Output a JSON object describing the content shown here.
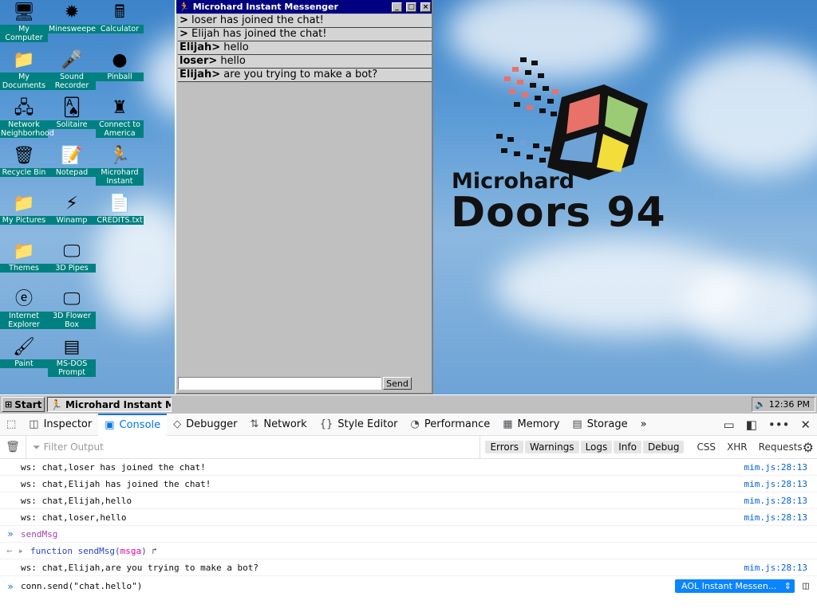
{
  "desktop": {
    "icons": [
      {
        "label": "My Computer",
        "icon": "computer-icon",
        "glyph": "🖥"
      },
      {
        "label": "Minesweeper",
        "icon": "mine-icon",
        "glyph": "✹"
      },
      {
        "label": "Calculator",
        "icon": "calculator-icon",
        "glyph": "🖩"
      },
      {
        "label": "My Documents",
        "icon": "folder-icon",
        "glyph": "📁"
      },
      {
        "label": "Sound Recorder",
        "icon": "microphone-icon",
        "glyph": "🎤"
      },
      {
        "label": "Pinball",
        "icon": "pinball-icon",
        "glyph": "●"
      },
      {
        "label": "Network Neighborhood",
        "icon": "network-icon",
        "glyph": "🖧"
      },
      {
        "label": "Solitaire",
        "icon": "cards-icon",
        "glyph": "🂡"
      },
      {
        "label": "Connect to America",
        "icon": "connect-icon",
        "glyph": "♜"
      },
      {
        "label": "Recycle Bin",
        "icon": "recycle-bin-icon",
        "glyph": "🗑"
      },
      {
        "label": "Notepad",
        "icon": "notepad-icon",
        "glyph": "📝"
      },
      {
        "label": "Microhard Instant",
        "icon": "running-man-icon",
        "glyph": "🏃"
      },
      {
        "label": "My Pictures",
        "icon": "folder-icon",
        "glyph": "📁"
      },
      {
        "label": "Winamp",
        "icon": "winamp-icon",
        "glyph": "⚡"
      },
      {
        "label": "CREDITS.txt",
        "icon": "text-file-icon",
        "glyph": "📄"
      },
      {
        "label": "Themes",
        "icon": "folder-icon",
        "glyph": "📁"
      },
      {
        "label": "3D Pipes",
        "icon": "monitor-icon",
        "glyph": "🖵"
      },
      {
        "label": "Internet Explorer",
        "icon": "ie-icon",
        "glyph": "ⓔ"
      },
      {
        "label": "3D Flower Box",
        "icon": "monitor-icon",
        "glyph": "🖵"
      },
      {
        "label": "Paint",
        "icon": "paint-icon",
        "glyph": "🖌"
      },
      {
        "label": "MS-DOS Prompt",
        "icon": "msdos-icon",
        "glyph": "▤"
      }
    ]
  },
  "messenger": {
    "title": "Microhard Instant Messenger",
    "lines": [
      {
        "prefix": ">",
        "text": " loser has joined the chat!"
      },
      {
        "prefix": ">",
        "text": " Elijah has joined the chat!"
      },
      {
        "prefix": "Elijah>",
        "text": " hello"
      },
      {
        "prefix": "loser>",
        "text": " hello"
      },
      {
        "prefix": "Elijah>",
        "text": " are you trying to make a bot?"
      }
    ],
    "input_value": "",
    "send_label": "Send"
  },
  "logo": {
    "line1": "Microhard",
    "line2": "Doors 94",
    "colors": {
      "red": "#e8716a",
      "green": "#9ccb75",
      "blue": "#6fa3d8",
      "yellow": "#f2dd3a"
    }
  },
  "taskbar": {
    "start_label": "Start",
    "task_label": "Microhard Instant M...",
    "clock": "12:36 PM"
  },
  "devtools": {
    "tabs": [
      {
        "label": "",
        "icon": "pick-element-icon",
        "glyph": "⬚"
      },
      {
        "label": "Inspector",
        "icon": "inspector-icon",
        "glyph": "◫"
      },
      {
        "label": "Console",
        "icon": "console-icon",
        "glyph": "▣",
        "active": true
      },
      {
        "label": "Debugger",
        "icon": "debugger-icon",
        "glyph": "◇"
      },
      {
        "label": "Network",
        "icon": "network-arrows-icon",
        "glyph": "⇅"
      },
      {
        "label": "Style Editor",
        "icon": "braces-icon",
        "glyph": "{}"
      },
      {
        "label": "Performance",
        "icon": "gauge-icon",
        "glyph": "◔"
      },
      {
        "label": "Memory",
        "icon": "chip-icon",
        "glyph": "▦"
      },
      {
        "label": "Storage",
        "icon": "storage-icon",
        "glyph": "▤"
      }
    ],
    "filter_placeholder": "Filter Output",
    "levels": [
      "Errors",
      "Warnings",
      "Logs",
      "Info",
      "Debug"
    ],
    "types": [
      "CSS",
      "XHR",
      "Requests"
    ],
    "rows": [
      {
        "kind": "log",
        "text": "ws: chat,loser has joined the chat!",
        "src": "mim.js:28:13"
      },
      {
        "kind": "log",
        "text": "ws: chat,Elijah has joined the chat!",
        "src": "mim.js:28:13"
      },
      {
        "kind": "log",
        "text": "ws: chat,Elijah,hello",
        "src": "mim.js:28:13"
      },
      {
        "kind": "log",
        "text": "ws: chat,loser,hello",
        "src": "mim.js:28:13"
      },
      {
        "kind": "input",
        "text": "sendMsg"
      },
      {
        "kind": "output",
        "kw": "function",
        "name": "sendMsg",
        "arg": "msga"
      },
      {
        "kind": "log",
        "text": "ws: chat,Elijah,are you trying to make a bot?",
        "src": "mim.js:28:13"
      }
    ],
    "prompt_value": "conn.send(\"chat.hello\")",
    "context_label": "AOL Instant Messen..."
  }
}
